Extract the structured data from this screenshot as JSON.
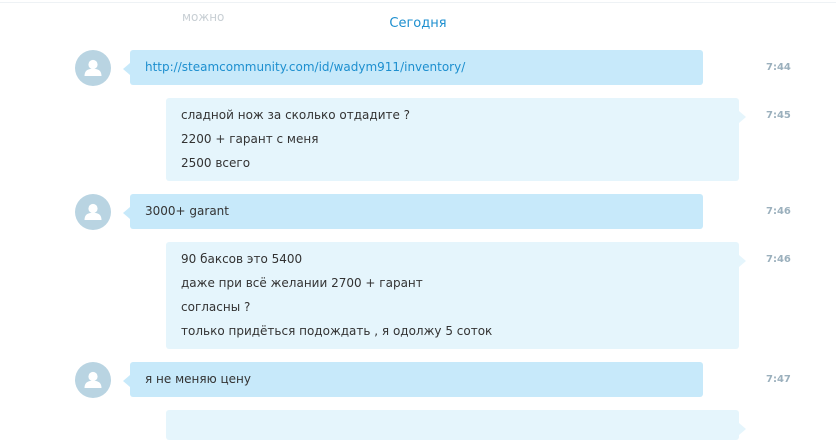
{
  "header": {
    "date_separator": "Сегодня",
    "cut_off_text": "можно"
  },
  "messages": [
    {
      "direction": "incoming",
      "time": "7:44",
      "lines": [
        "http://steamcommunity.com/id/wadym911/inventory/"
      ],
      "is_link": true
    },
    {
      "direction": "outgoing",
      "time": "7:45",
      "lines": [
        "сладной нож за сколько отдадите ?",
        "2200 + гарант с меня",
        "2500 всего"
      ]
    },
    {
      "direction": "incoming",
      "time": "7:46",
      "lines": [
        "3000+ garant"
      ]
    },
    {
      "direction": "outgoing",
      "time": "7:46",
      "lines": [
        "90 баксов это 5400",
        "даже при всё желании 2700 + гарант",
        "согласны ?",
        "только придёться подождать , я одолжу 5 соток"
      ]
    },
    {
      "direction": "incoming",
      "time": "7:47",
      "lines": [
        "я не меняю цену"
      ]
    }
  ],
  "colors": {
    "incoming_bubble": "#c7e9fa",
    "outgoing_bubble": "#e5f5fc",
    "accent": "#1d8fcf",
    "avatar": "#b9d4e2"
  },
  "icons": {
    "avatar": "default-user-avatar-icon"
  }
}
